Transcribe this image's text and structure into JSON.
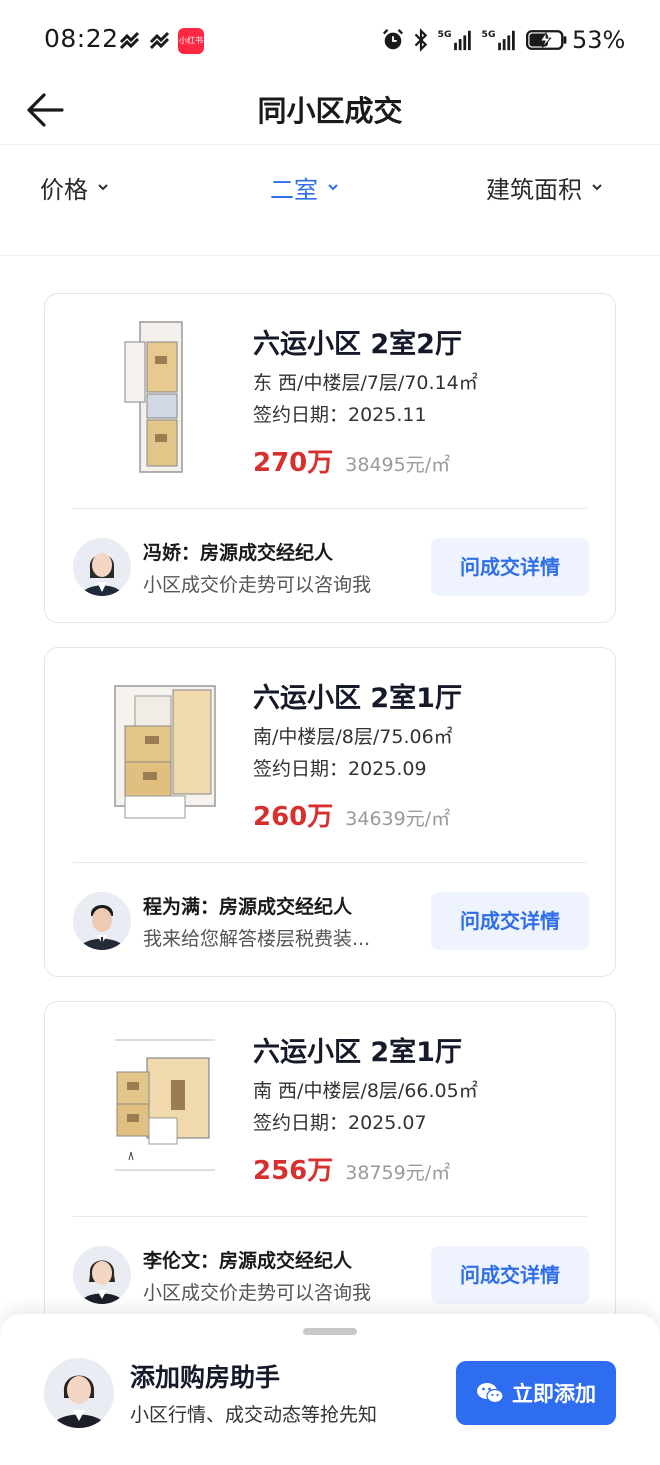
{
  "status_bar": {
    "time": "08:22",
    "app_badge": "小红书",
    "network": "5G",
    "battery_percent": "53%",
    "icons": [
      "alarm-icon",
      "bluetooth-icon",
      "signal-icon",
      "battery-icon"
    ]
  },
  "header": {
    "title": "同小区成交",
    "back_icon": "back-arrow-icon"
  },
  "filters": [
    {
      "label": "价格",
      "active": false
    },
    {
      "label": "二室",
      "active": true
    },
    {
      "label": "建筑面积",
      "active": false
    }
  ],
  "colors": {
    "accent": "#2f6ee8",
    "price": "#d6302f",
    "button_bg": "#eef3fd",
    "primary_button": "#2e6cf0"
  },
  "listings": [
    {
      "title": "六运小区 2室2厅",
      "attrs": "东 西/中楼层/7层/70.14㎡",
      "date": "签约日期：2025.11",
      "price": "270万",
      "unit_price": "38495元/㎡",
      "agent_name": "冯娇：房源成交经纪人",
      "agent_message": "小区成交价走势可以咨询我",
      "button_label": "问成交详情"
    },
    {
      "title": "六运小区 2室1厅",
      "attrs": "南/中楼层/8层/75.06㎡",
      "date": "签约日期：2025.09",
      "price": "260万",
      "unit_price": "34639元/㎡",
      "agent_name": "程为满：房源成交经纪人",
      "agent_message": "我来给您解答楼层税费装...",
      "button_label": "问成交详情"
    },
    {
      "title": "六运小区 2室1厅",
      "attrs": "南 西/中楼层/8层/66.05㎡",
      "date": "签约日期：2025.07",
      "price": "256万",
      "unit_price": "38759元/㎡",
      "agent_name": "李伦文：房源成交经纪人",
      "agent_message": "小区成交价走势可以咨询我",
      "button_label": "问成交详情"
    }
  ],
  "bottom_sheet": {
    "title": "添加购房助手",
    "subtitle": "小区行情、成交动态等抢先知",
    "button_label": "立即添加",
    "button_icon": "wechat-icon"
  }
}
